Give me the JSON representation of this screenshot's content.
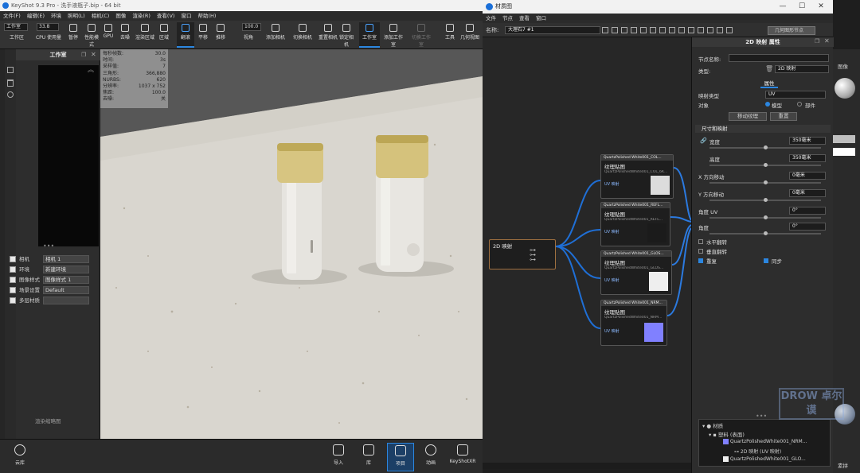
{
  "main_window": {
    "title": "KeyShot 9.3 Pro - 洗手液瓶子.bip - 64 bit"
  },
  "main_menu": [
    "文件(F)",
    "编辑(E)",
    "环境",
    "照明(L)",
    "相机(C)",
    "图像",
    "渲染(R)",
    "查看(V)",
    "窗口",
    "帮助(H)"
  ],
  "toolbar": {
    "workspace_select": "工作室",
    "cpu_value": "33.8",
    "zoom_value": "100.0",
    "items": [
      "工作区",
      "CPU 使用量",
      "暂停",
      "性能模式",
      "GPU",
      "去噪",
      "渲染区域",
      "区域",
      "翻滚",
      "平移",
      "推移",
      "视角",
      "添加相机",
      "切换相机",
      "重置相机",
      "锁定相机",
      "工作室",
      "添加工作室",
      "切换工作室",
      "工具",
      "几何视图"
    ]
  },
  "left_panel": {
    "title": "工作室",
    "placeholder": "渲染缩略图",
    "rows": [
      {
        "label": "相机",
        "value": "相机 1"
      },
      {
        "label": "环境",
        "value": "新建环境"
      },
      {
        "label": "图像样式",
        "value": "图像样式 1"
      },
      {
        "label": "场景设置",
        "value": "Default"
      },
      {
        "label": "多层材质",
        "value": ""
      }
    ]
  },
  "hud": [
    {
      "k": "每秒帧数:",
      "v": "30.0"
    },
    {
      "k": "时间:",
      "v": "3s"
    },
    {
      "k": "采样值:",
      "v": "7"
    },
    {
      "k": "三角形:",
      "v": "366,880"
    },
    {
      "k": "NURBS:",
      "v": "620"
    },
    {
      "k": "分辨率:",
      "v": "1037 x 752"
    },
    {
      "k": "焦距:",
      "v": "100.0"
    },
    {
      "k": "去噪:",
      "v": "关"
    }
  ],
  "bottom_bar": {
    "items": [
      "云库",
      "导入",
      "库",
      "项目",
      "动画",
      "KeyShotXR"
    ]
  },
  "material_window": {
    "title": "材质图",
    "menu": [
      "文件",
      "节点",
      "查看",
      "窗口"
    ],
    "name_label": "名称:",
    "name_value": "大理石7 #1",
    "geometry_node_button": "几何图形节点"
  },
  "graph": {
    "source_node": "2D 映射",
    "nodes": [
      {
        "header": "QuartzPolished White001_COL...",
        "title": "纹理贴图",
        "sub": "QuartzPolishedWhite001_COL_6K...",
        "pin": "UV 映射",
        "color": "#dcdcdc"
      },
      {
        "header": "QuartzPolished White001_REFL...",
        "title": "纹理贴图",
        "sub": "QuartzPolishedWhite001_REFL...",
        "pin": "UV 映射",
        "color": "#1b1b1b"
      },
      {
        "header": "QuartzPolished White001_GLOS...",
        "title": "纹理贴图",
        "sub": "QuartzPolishedWhite001_GLOS...",
        "pin": "UV 映射",
        "color": "#eeeeee"
      },
      {
        "header": "QuartzPolished White001_NRM...",
        "title": "纹理贴图",
        "sub": "QuartzPolishedWhite001_NRM...",
        "pin": "UV 映射",
        "color": "#8080ff"
      }
    ]
  },
  "props": {
    "title": "2D 映射 属性",
    "node_name_label": "节点名称:",
    "type_label": "类型:",
    "type_value": "2D 映射",
    "tab": "属性",
    "mapping_type_label": "映射类型",
    "mapping_type_value": "UV",
    "object_label": "对象",
    "object_opt1": "模型",
    "object_opt2": "部件",
    "move_texture_btn": "移动纹理",
    "reset_btn": "重置",
    "section": "尺寸和映射",
    "fields": [
      {
        "label": "宽度",
        "value": "350毫米",
        "level": 0.5
      },
      {
        "label": "高度",
        "value": "350毫米",
        "level": 0.5
      },
      {
        "label": "X 方向移动",
        "value": "0毫米",
        "level": 0.5
      },
      {
        "label": "Y 方向移动",
        "value": "0毫米",
        "level": 0.5
      },
      {
        "label": "角度 UV",
        "value": "0°",
        "level": 0.5
      },
      {
        "label": "角度",
        "value": "0°",
        "level": 0.5
      }
    ],
    "flip_h": "水平翻转",
    "flip_v": "垂直翻转",
    "repeat": "重复",
    "sync": "同步"
  },
  "tree": {
    "root": "材质",
    "child": "塑料 (表面)",
    "items": [
      "QuartzPolishedWhite001_NRM...",
      "2D 映射 (UV 映射)",
      "QuartzPolishedWhite001_GLO..."
    ]
  },
  "right_strip": {
    "top_label": "图像",
    "bottom_label": "素拼"
  },
  "watermark": "DROW 卓尔谟"
}
